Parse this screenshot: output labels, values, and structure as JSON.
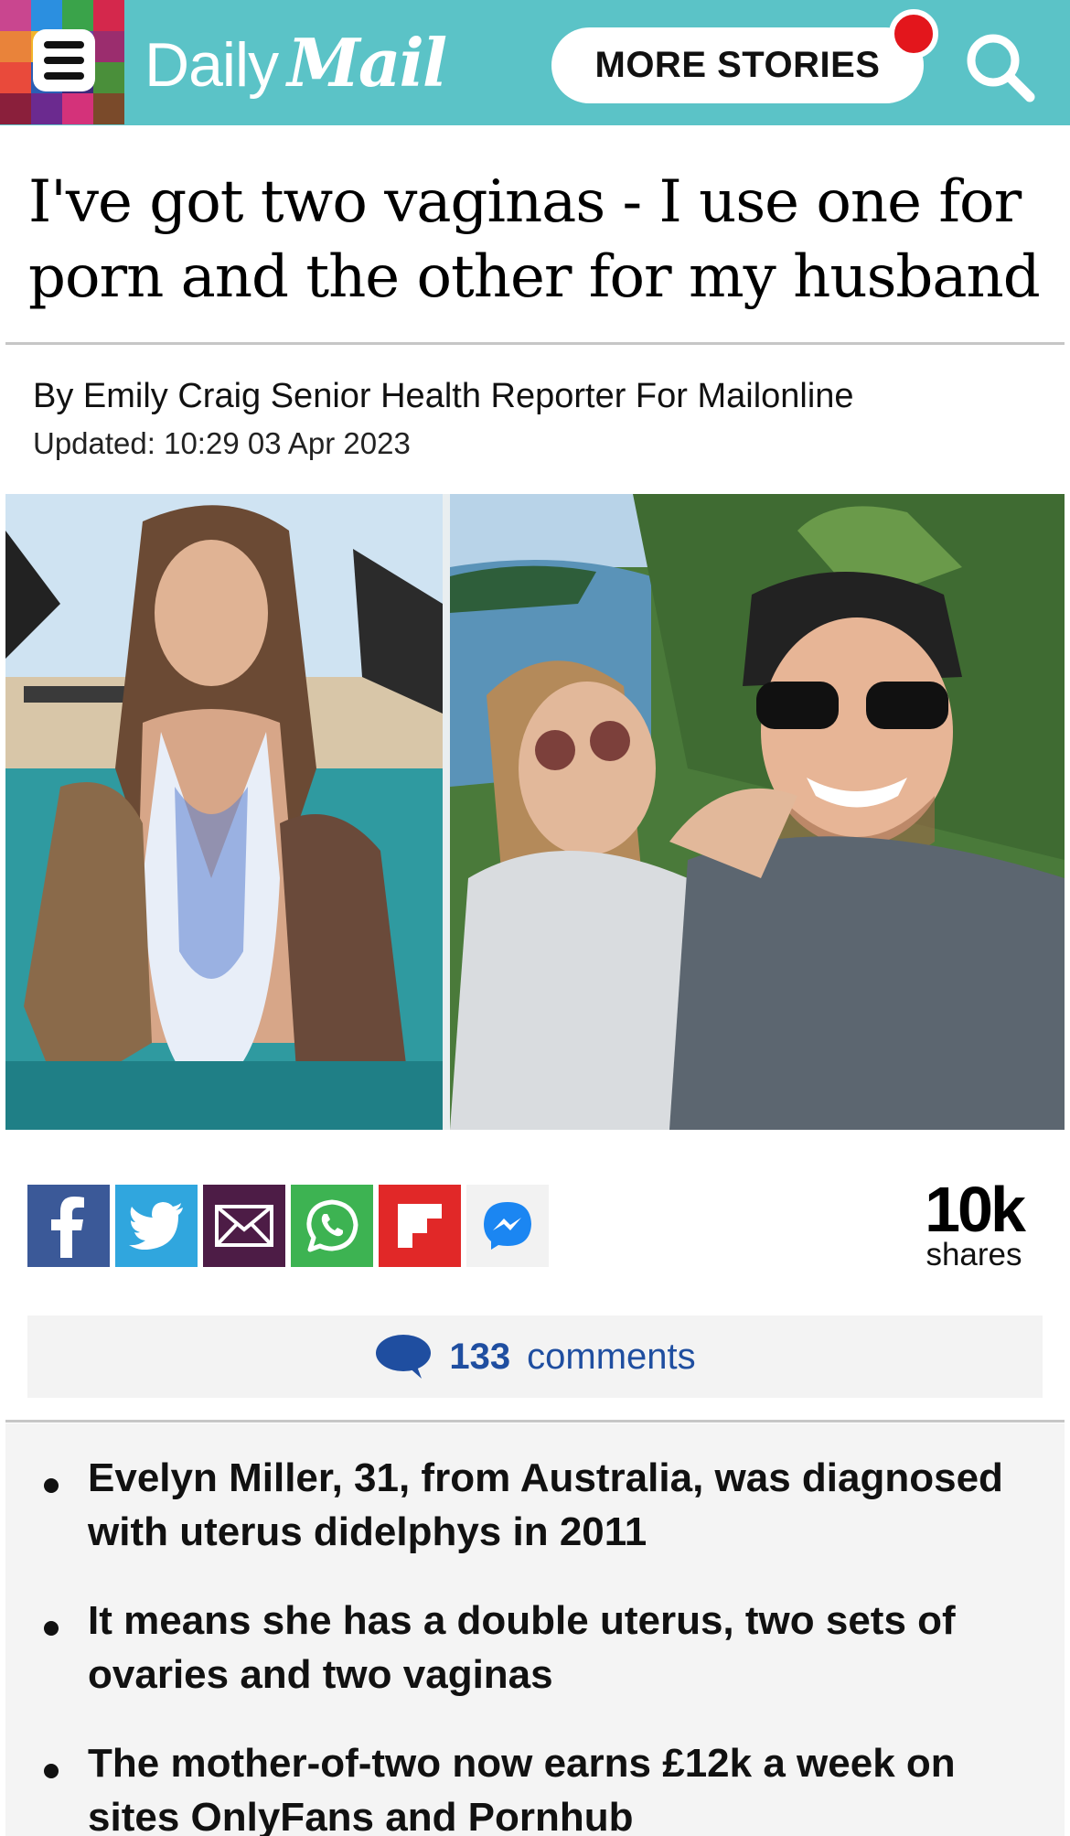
{
  "header": {
    "logo_daily": "Daily",
    "logo_mail": "Mail",
    "more_stories_label": "MORE STORIES",
    "brand_color": "#5bc3c7",
    "notification_color": "#e3161c",
    "icons": [
      "hamburger-menu-icon",
      "search-icon"
    ]
  },
  "article": {
    "headline": "I've got two vaginas - I use one for porn and the other for my husband",
    "byline": "By Emily Craig Senior Health Reporter For Mailonline",
    "updated": "Updated: 10:29 03 Apr 2023",
    "photo_panels": [
      "woman-in-swimsuit-photo",
      "couple-selfie-photo"
    ]
  },
  "share": {
    "buttons": [
      "facebook-icon",
      "twitter-icon",
      "email-icon",
      "whatsapp-icon",
      "flipboard-icon",
      "messenger-icon"
    ],
    "count": "10k",
    "count_label": "shares"
  },
  "comments": {
    "count": "133",
    "label": "comments",
    "link_color": "#1f4ea0"
  },
  "bullets": [
    "Evelyn Miller, 31, from Australia, was diagnosed with uterus didelphys in 2011",
    "It means she has a double uterus, two sets of ovaries and two vaginas",
    "The mother-of-two now earns £12k a week on sites OnlyFans and Pornhub"
  ]
}
